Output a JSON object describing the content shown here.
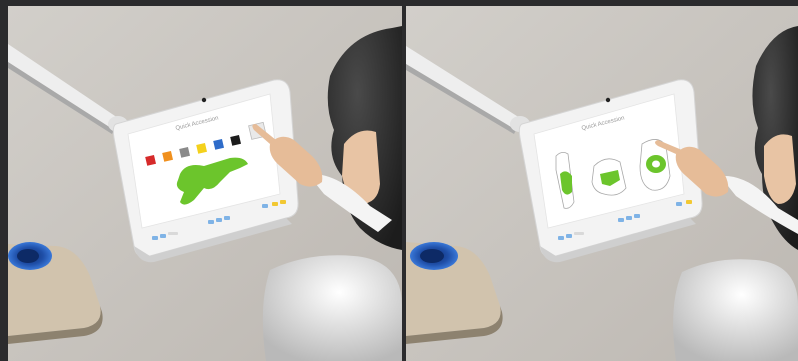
{
  "left_panel": {
    "screen_title": "Quick Accession",
    "swatches": [
      "#d62a2a",
      "#f0901e",
      "#8a8a8a",
      "#f4d11c",
      "#2e6cc9",
      "#1c1c1c",
      "#e9e9e9"
    ],
    "shape_color": "#6cc52c"
  },
  "right_panel": {
    "screen_title": "Quick Accession",
    "shape_color": "#6cc52c"
  },
  "colors": {
    "background_wall": "#c9c5c0",
    "divider": "#2b2b2d",
    "device_bezel": "#f3f3f3",
    "screen": "#ffffff",
    "blue_light": "#1f4fa8",
    "table_top": "#cfc1ac"
  }
}
